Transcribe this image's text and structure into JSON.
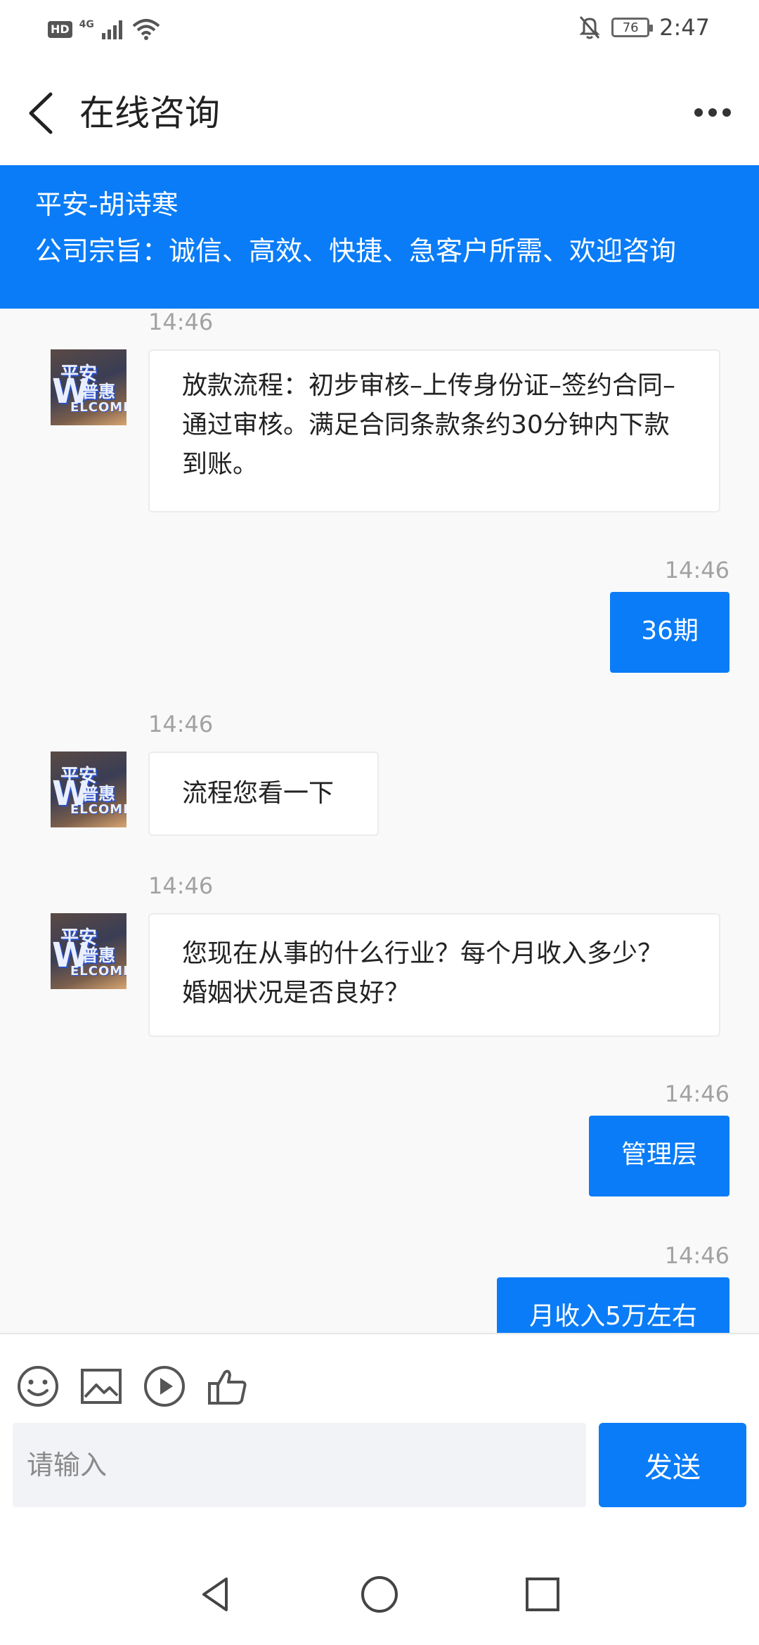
{
  "status_bar": {
    "hd": "HD",
    "network": "4G",
    "battery": "76",
    "time": "2:47"
  },
  "header": {
    "title": "在线咨询"
  },
  "banner": {
    "name": "平安-胡诗寒",
    "motto": "公司宗旨：诚信、高效、快捷、急客户所需、欢迎咨询"
  },
  "avatar": {
    "line1": "平安",
    "line2": "普惠",
    "letter": "W",
    "line3": "ELCOME"
  },
  "messages": [
    {
      "time": "14:46",
      "side": "in",
      "text": "放款流程：初步审核–上传身份证–签约合同–通过审核。满足合同条款条约30分钟内下款到账。"
    },
    {
      "time": "14:46",
      "side": "out",
      "text": "36期"
    },
    {
      "time": "14:46",
      "side": "in",
      "text": "流程您看一下"
    },
    {
      "time": "14:46",
      "side": "in",
      "text": "您现在从事的什么行业？每个月收入多少？婚姻状况是否良好？"
    },
    {
      "time": "14:46",
      "side": "out",
      "text": "管理层"
    },
    {
      "time": "14:46",
      "side": "out",
      "text": "月收入5万左右"
    }
  ],
  "input": {
    "placeholder": "请输入",
    "send_label": "发送"
  },
  "icons": {
    "emoji": "emoji-icon",
    "image": "image-icon",
    "video": "video-play-icon",
    "like": "thumbs-up-icon"
  },
  "colors": {
    "accent": "#0a7cf7",
    "chat_bg": "#f9f9f9",
    "timestamp": "#a2a2a2"
  }
}
